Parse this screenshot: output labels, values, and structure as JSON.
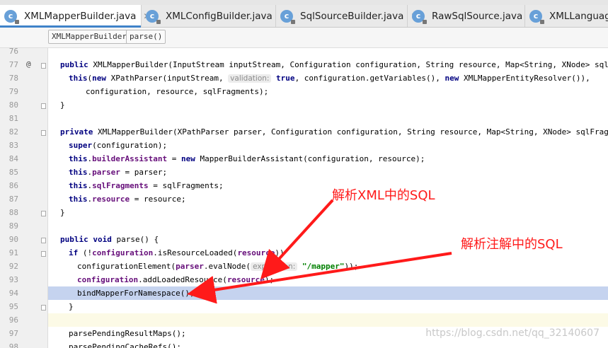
{
  "editor": {
    "tabs": [
      {
        "label": "XMLMapperBuilder.java",
        "active": true
      },
      {
        "label": "XMLConfigBuilder.java",
        "active": false
      },
      {
        "label": "SqlSourceBuilder.java",
        "active": false
      },
      {
        "label": "RawSqlSource.java",
        "active": false
      },
      {
        "label": "XMLLanguageDriv",
        "active": false
      }
    ],
    "breadcrumbs": [
      "XMLMapperBuilder",
      "parse()"
    ],
    "lines": [
      {
        "n": "76"
      },
      {
        "n": "77",
        "mark": "@",
        "fold": true,
        "parts": [
          [
            "kw",
            "public "
          ],
          [
            "",
            "XMLMapperBuilder(InputStream inputStream, Configuration configuration, String resource, Map<String, XNode> sqlFragments) {"
          ]
        ]
      },
      {
        "n": "78",
        "indent": 1,
        "parts": [
          [
            "kw",
            "this"
          ],
          [
            "",
            "("
          ],
          [
            "kw",
            "new "
          ],
          [
            "",
            "XPathParser(inputStream, "
          ],
          [
            "hint",
            "validation:"
          ],
          [
            "",
            ""
          ],
          [
            "kw",
            " true"
          ],
          [
            "",
            ", configuration.getVariables(), "
          ],
          [
            "kw",
            "new "
          ],
          [
            "",
            "XMLMapperEntityResolver()),"
          ]
        ]
      },
      {
        "n": "79",
        "indent": 3,
        "parts": [
          [
            "",
            "configuration, resource, sqlFragments);"
          ]
        ]
      },
      {
        "n": "80",
        "fold": true,
        "parts": [
          [
            "",
            "}"
          ]
        ]
      },
      {
        "n": "81"
      },
      {
        "n": "82",
        "fold": true,
        "parts": [
          [
            "kw",
            "private "
          ],
          [
            "",
            "XMLMapperBuilder(XPathParser parser, Configuration configuration, String resource, Map<String, XNode> sqlFragments) {"
          ]
        ]
      },
      {
        "n": "83",
        "indent": 1,
        "parts": [
          [
            "kw",
            "super"
          ],
          [
            "",
            "(configuration);"
          ]
        ]
      },
      {
        "n": "84",
        "indent": 1,
        "parts": [
          [
            "kw",
            "this"
          ],
          [
            "",
            "."
          ],
          [
            "fld",
            "builderAssistant"
          ],
          [
            "",
            " = "
          ],
          [
            "kw",
            "new "
          ],
          [
            "",
            "MapperBuilderAssistant(configuration, resource);"
          ]
        ]
      },
      {
        "n": "85",
        "indent": 1,
        "parts": [
          [
            "kw",
            "this"
          ],
          [
            "",
            "."
          ],
          [
            "fld",
            "parser"
          ],
          [
            "",
            " = parser;"
          ]
        ]
      },
      {
        "n": "86",
        "indent": 1,
        "parts": [
          [
            "kw",
            "this"
          ],
          [
            "",
            "."
          ],
          [
            "fld",
            "sqlFragments"
          ],
          [
            "",
            " = sqlFragments;"
          ]
        ]
      },
      {
        "n": "87",
        "indent": 1,
        "parts": [
          [
            "kw",
            "this"
          ],
          [
            "",
            "."
          ],
          [
            "fld",
            "resource"
          ],
          [
            "",
            " = resource;"
          ]
        ]
      },
      {
        "n": "88",
        "fold": true,
        "parts": [
          [
            "",
            "}"
          ]
        ]
      },
      {
        "n": "89"
      },
      {
        "n": "90",
        "fold": true,
        "parts": [
          [
            "kw",
            "public void "
          ],
          [
            "",
            "parse() {"
          ]
        ]
      },
      {
        "n": "91",
        "indent": 1,
        "fold": true,
        "parts": [
          [
            "kw",
            "if "
          ],
          [
            "",
            "(!"
          ],
          [
            "fld",
            "configuration"
          ],
          [
            "",
            ".isResourceLoaded("
          ],
          [
            "fld",
            "resource"
          ],
          [
            "",
            "))"
          ]
        ]
      },
      {
        "n": "92",
        "indent": 2,
        "parts": [
          [
            "",
            "configurationElement("
          ],
          [
            "fld",
            "parser"
          ],
          [
            "",
            ".evalNode("
          ],
          [
            "hint",
            "expression:"
          ],
          [
            "str",
            " \"/mapper\""
          ],
          [
            "",
            "));"
          ]
        ]
      },
      {
        "n": "93",
        "indent": 2,
        "parts": [
          [
            "fld",
            "configuration"
          ],
          [
            "",
            ".addLoadedResource("
          ],
          [
            "fld",
            "resource"
          ],
          [
            "",
            ");"
          ]
        ]
      },
      {
        "n": "94",
        "indent": 2,
        "hl": true,
        "parts": [
          [
            "",
            "bindMapperForNamespace();"
          ]
        ]
      },
      {
        "n": "95",
        "indent": 1,
        "fold": true,
        "parts": [
          [
            "",
            "}"
          ]
        ]
      },
      {
        "n": "96",
        "cur": true
      },
      {
        "n": "97",
        "indent": 1,
        "parts": [
          [
            "",
            "parsePendingResultMaps();"
          ]
        ]
      },
      {
        "n": "98",
        "indent": 1,
        "parts": [
          [
            "",
            "parsePendingCacheRefs();"
          ]
        ]
      }
    ]
  },
  "annotations": {
    "xml_sql": "解析XML中的SQL",
    "annotation_sql": "解析注解中的SQL",
    "color": "#ff1a1a"
  },
  "watermark": "https://blog.csdn.net/qq_32140607"
}
